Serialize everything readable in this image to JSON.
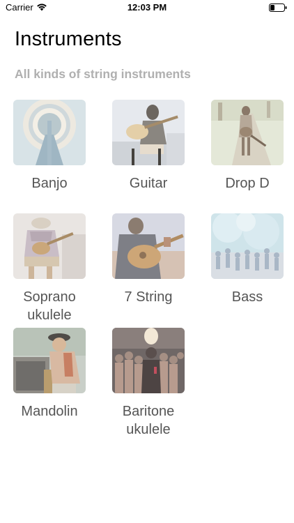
{
  "status_bar": {
    "carrier": "Carrier",
    "time": "12:03 PM"
  },
  "header": {
    "title": "Instruments",
    "subtitle": "All kinds of string instruments"
  },
  "instruments": [
    {
      "label": "Banjo",
      "image": "banjo-photo"
    },
    {
      "label": "Guitar",
      "image": "guitar-player-photo"
    },
    {
      "label": "Drop D",
      "image": "girl-with-guitar-photo"
    },
    {
      "label": "Soprano ukulele",
      "image": "ukulele-player-photo"
    },
    {
      "label": "7 String",
      "image": "acoustic-guitar-photo"
    },
    {
      "label": "Bass",
      "image": "crowd-festival-photo"
    },
    {
      "label": "Mandolin",
      "image": "child-with-amp-photo"
    },
    {
      "label": "Baritone ukulele",
      "image": "concert-crowd-photo"
    }
  ],
  "colors": {
    "subtitle": "#b0b0b0",
    "label": "#555555"
  }
}
